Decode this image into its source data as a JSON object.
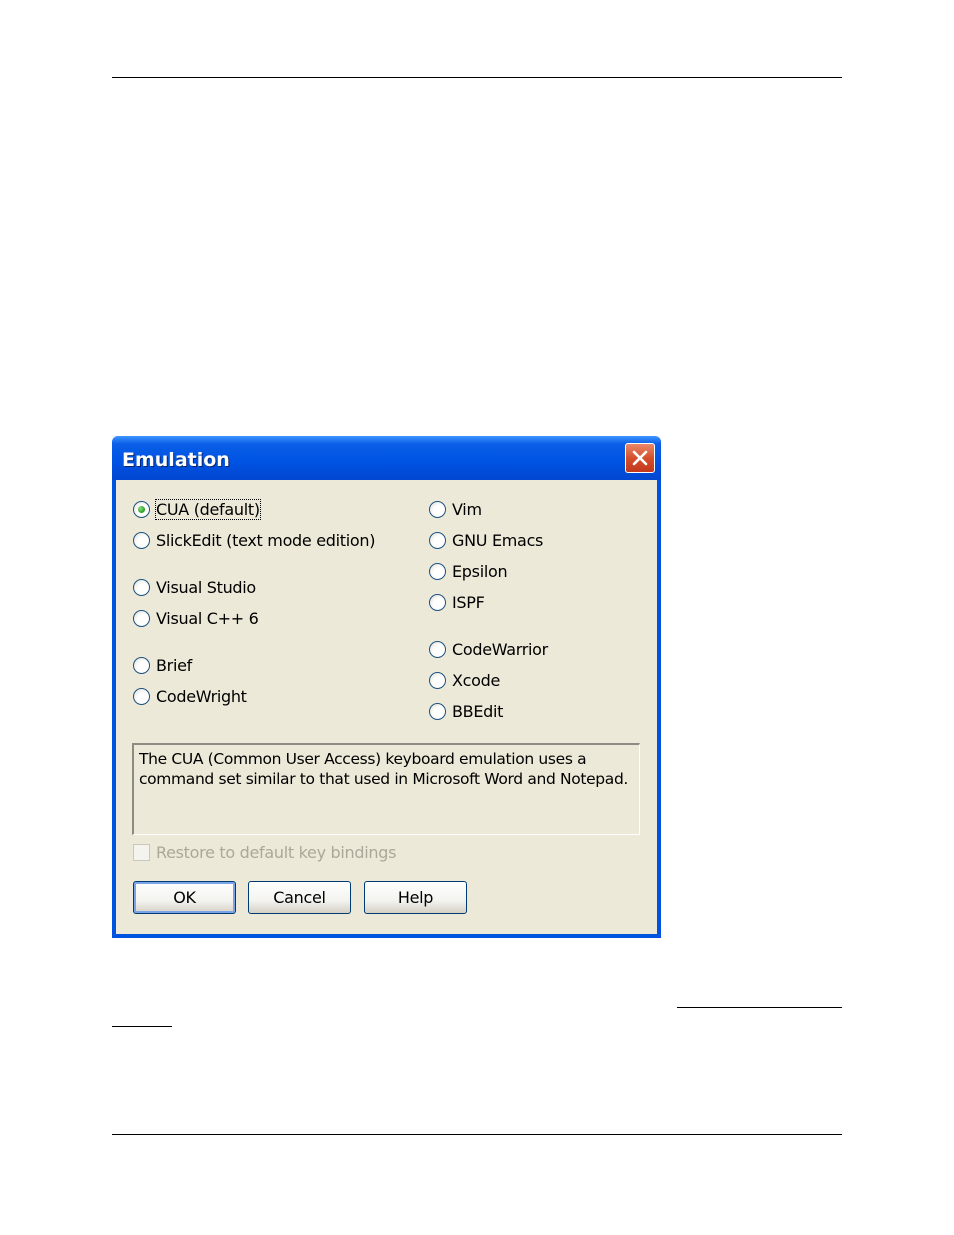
{
  "dialog": {
    "title": "Emulation",
    "options_left": [
      {
        "label": "CUA (default)",
        "checked": true
      },
      {
        "label": "SlickEdit (text mode edition)",
        "checked": false
      },
      {
        "label": "Visual Studio",
        "checked": false
      },
      {
        "label": "Visual C++ 6",
        "checked": false
      },
      {
        "label": "Brief",
        "checked": false
      },
      {
        "label": "CodeWright",
        "checked": false
      }
    ],
    "options_right": [
      {
        "label": "Vim",
        "checked": false
      },
      {
        "label": "GNU Emacs",
        "checked": false
      },
      {
        "label": "Epsilon",
        "checked": false
      },
      {
        "label": "ISPF",
        "checked": false
      },
      {
        "label": "CodeWarrior",
        "checked": false
      },
      {
        "label": "Xcode",
        "checked": false
      },
      {
        "label": "BBEdit",
        "checked": false
      }
    ],
    "description": "The CUA (Common User Access) keyboard emulation uses a command set similar to that used in Microsoft Word and Notepad.",
    "restore_checkbox": {
      "label": "Restore to default key bindings",
      "checked": false,
      "enabled": false
    },
    "buttons": {
      "ok": "OK",
      "cancel": "Cancel",
      "help": "Help"
    },
    "close_icon": "close-icon",
    "colors": {
      "title_bar": "#0054e3",
      "client_bg": "#ece9d8",
      "close_button": "#d6502c"
    }
  }
}
